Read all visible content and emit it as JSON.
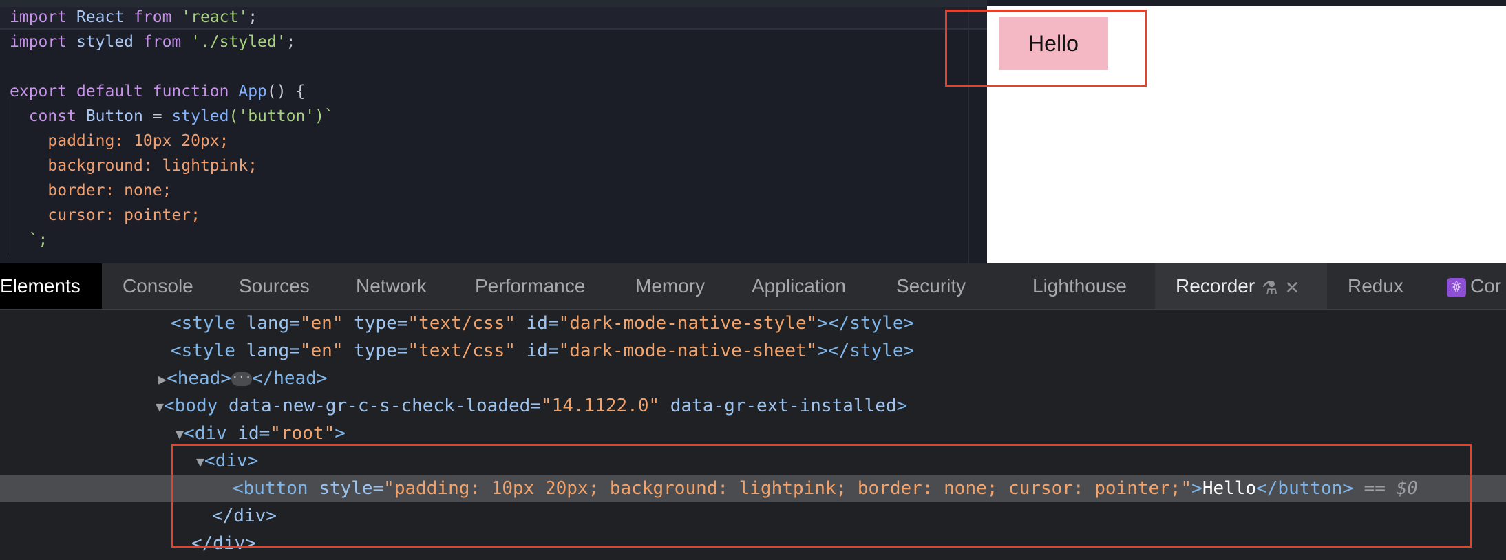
{
  "editor": {
    "lines": [
      {
        "t1": "import",
        "t2": " React",
        "t3": " from ",
        "t4": "'react'",
        "t5": ";"
      },
      {
        "t1": "import",
        "t2": " styled",
        "t3": " from ",
        "t4": "'./styled'",
        "t5": ";"
      },
      {
        "t1": "export",
        "t2": " default",
        "t3": " function",
        "t4": " App",
        "t5": "() {"
      },
      {
        "t1": "  const",
        "t2": " Button",
        "t3": " = ",
        "t4": "styled",
        "t5": "('button')`"
      },
      {
        "text": "    padding: 10px 20px;"
      },
      {
        "text": "    background: lightpink;"
      },
      {
        "text": "    border: none;"
      },
      {
        "text": "    cursor: pointer;"
      },
      {
        "text": "  `;"
      }
    ]
  },
  "preview": {
    "button_label": "Hello"
  },
  "devtools": {
    "tabs": [
      "Elements",
      "Console",
      "Sources",
      "Network",
      "Performance",
      "Memory",
      "Application",
      "Security",
      "Lighthouse",
      "Recorder",
      "Redux",
      "Cor"
    ],
    "active_tab": "Elements"
  },
  "dom": {
    "style1": {
      "tag": "style",
      "lang": "en",
      "type": "text/css",
      "id": "dark-mode-native-style"
    },
    "style2": {
      "tag": "style",
      "lang": "en",
      "type": "text/css",
      "id": "dark-mode-native-sheet"
    },
    "head": {
      "open": "<head>",
      "close": "</head>",
      "ellipsis": "···"
    },
    "body": {
      "attr1_name": "data-new-gr-c-s-check-loaded",
      "attr1_value": "14.1122.0",
      "attr2_name": "data-gr-ext-installed"
    },
    "root_div": {
      "id": "root"
    },
    "inner_div": {
      "open": "<div>",
      "close": "</div>"
    },
    "button": {
      "style": "padding: 10px 20px; background: lightpink; border: none; cursor: pointer;",
      "text": "Hello",
      "selected_marker": "== $0"
    },
    "root_close": "</div>"
  },
  "colors": {
    "highlight": "#e5412b",
    "button_bg": "#f4b8c4"
  }
}
